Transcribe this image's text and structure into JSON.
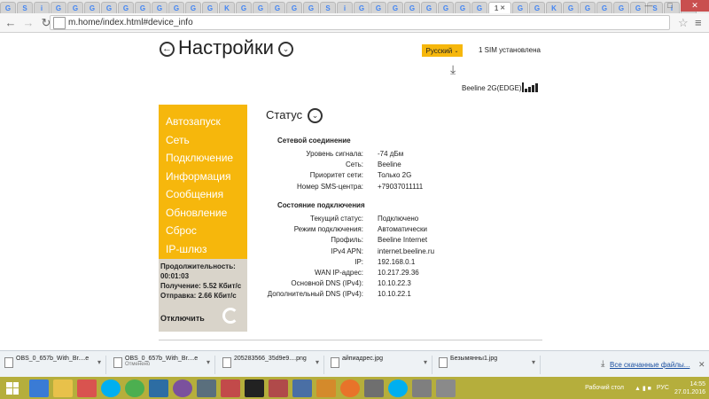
{
  "browser": {
    "url": "m.home/index.html#device_info",
    "tab_count": 40,
    "active_tab_label": "1"
  },
  "header": {
    "title": "Настройки",
    "language": "Русский",
    "sim_status": "1 SIM установлена",
    "network": "Beeline 2G(EDGE)"
  },
  "sidebar": {
    "items": [
      {
        "label": "Автозапуск"
      },
      {
        "label": "Сеть"
      },
      {
        "label": "Подключение"
      },
      {
        "label": "Информация"
      },
      {
        "label": "Сообщения"
      },
      {
        "label": "Обновление"
      },
      {
        "label": "Сброс"
      },
      {
        "label": "IP-шлюз"
      }
    ],
    "active_index": 3
  },
  "stats": {
    "duration_label": "Продолжительность:",
    "duration_value": "00:01:03",
    "received": "Получение: 5.52 Кбит/с",
    "sent": "Отправка: 2.66 Кбит/с",
    "disconnect": "Отключить"
  },
  "main": {
    "status_title": "Статус",
    "network_section": {
      "title": "Сетевой соединение",
      "rows": [
        {
          "label": "Уровень сигнала:",
          "value": "-74 дБм"
        },
        {
          "label": "Сеть:",
          "value": "Beeline"
        },
        {
          "label": "Приоритет сети:",
          "value": "Только 2G"
        },
        {
          "label": "Номер SMS-центра:",
          "value": "+79037011111"
        }
      ]
    },
    "connection_section": {
      "title": "Состояние подключения",
      "rows": [
        {
          "label": "Текущий статус:",
          "value": "Подключено"
        },
        {
          "label": "Режим подключения:",
          "value": "Автоматически"
        },
        {
          "label": "Профиль:",
          "value": "Beeline Internet"
        },
        {
          "label": "IPv4 APN:",
          "value": "internet.beeline.ru"
        },
        {
          "label": "IP:",
          "value": "192.168.0.1"
        },
        {
          "label": "WAN IP-адрес:",
          "value": "10.217.29.36"
        },
        {
          "label": "Основной DNS (IPv4):",
          "value": "10.10.22.3"
        },
        {
          "label": "Дополнительный DNS (IPv4):",
          "value": "10.10.22.1"
        }
      ]
    }
  },
  "downloads": {
    "items": [
      {
        "name": "OBS_0_657b_With_Br....e",
        "sub": ""
      },
      {
        "name": "OBS_0_657b_With_Br....e",
        "sub": "Отменено"
      },
      {
        "name": "205283566_35d9e9....png",
        "sub": ""
      },
      {
        "name": "айпиадрес.jpg",
        "sub": ""
      },
      {
        "name": "Безымянны1.jpg",
        "sub": ""
      }
    ],
    "show_all": "Все скачанные файлы..."
  },
  "taskbar": {
    "desktop_label": "Рабочий стол",
    "lang": "РУС",
    "time": "14:55",
    "date": "27.01.2016"
  },
  "colors": {
    "accent": "#f6b70c",
    "stats_bg": "#d9d4ca",
    "taskbar": "#b5ae3c"
  }
}
